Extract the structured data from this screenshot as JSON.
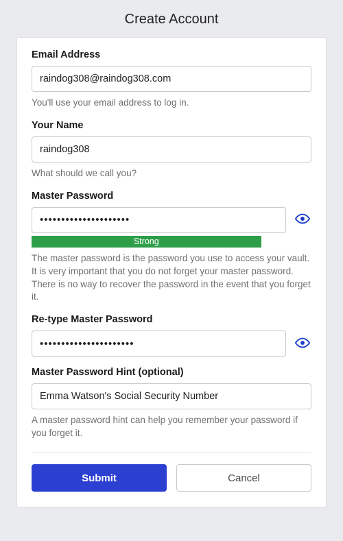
{
  "title": "Create Account",
  "email": {
    "label": "Email Address",
    "value": "raindog308@raindog308.com",
    "help": "You'll use your email address to log in."
  },
  "name": {
    "label": "Your Name",
    "value": "raindog308",
    "help": "What should we call you?"
  },
  "password": {
    "label": "Master Password",
    "value": "•••••••••••••••••••••",
    "strength": "Strong",
    "help": "The master password is the password you use to access your vault. It is very important that you do not forget your master password. There is no way to recover the password in the event that you forget it."
  },
  "retype": {
    "label": "Re-type Master Password",
    "value": "••••••••••••••••••••••"
  },
  "hint": {
    "label": "Master Password Hint (optional)",
    "value": "Emma Watson's Social Security Number",
    "help": "A master password hint can help you remember your password if you forget it."
  },
  "buttons": {
    "submit": "Submit",
    "cancel": "Cancel"
  }
}
